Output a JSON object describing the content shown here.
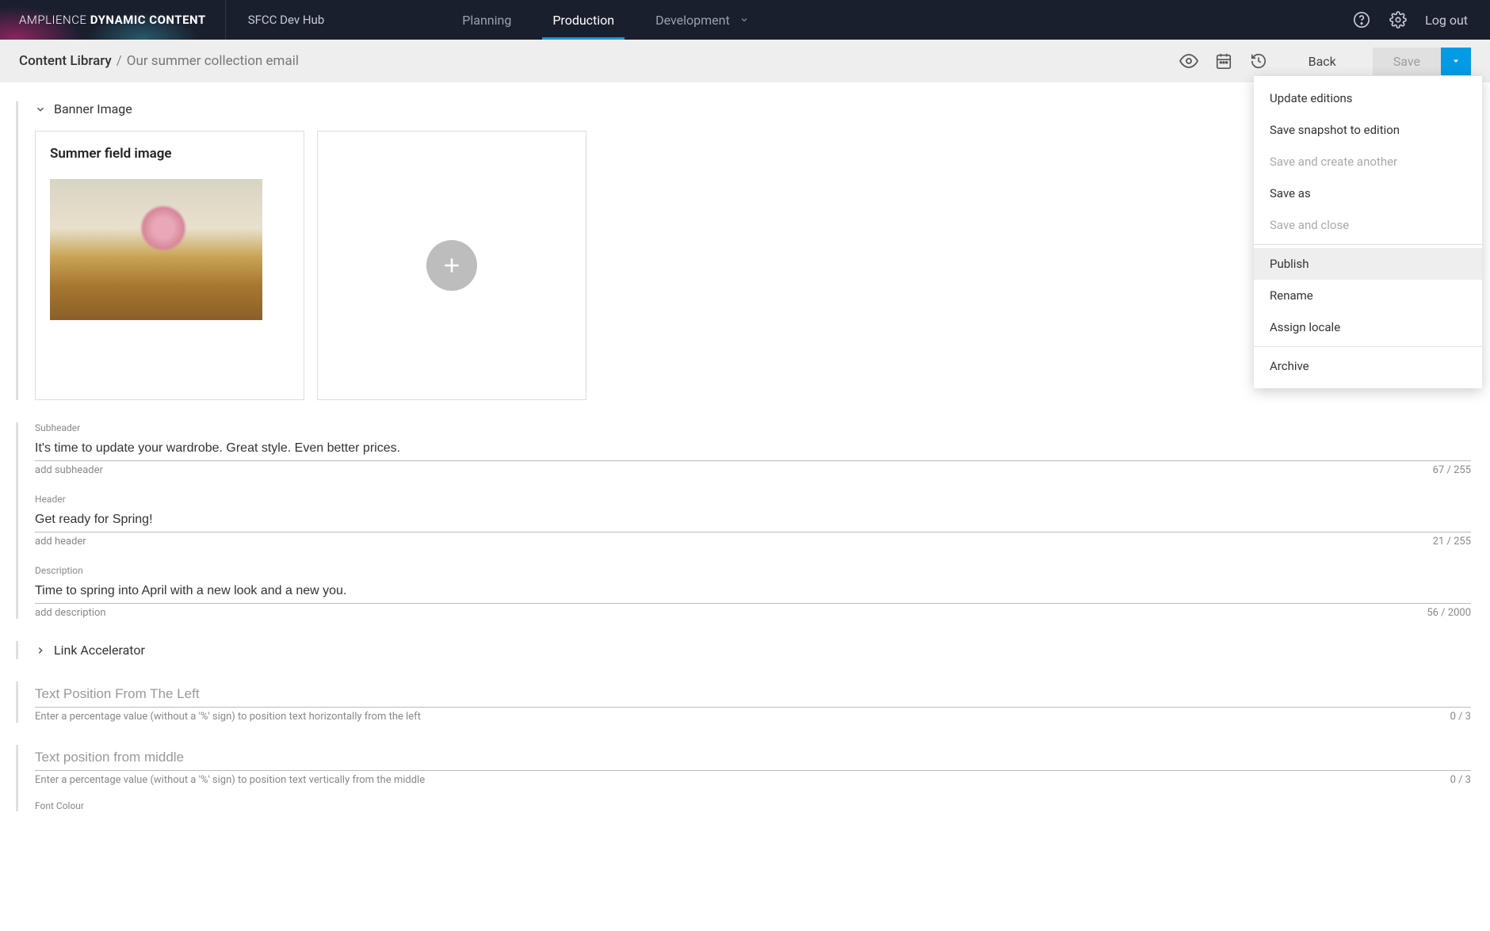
{
  "brand": {
    "light": "AMPLIENCE",
    "bold": "DYNAMIC CONTENT"
  },
  "hub": "SFCC Dev Hub",
  "nav": {
    "planning": "Planning",
    "production": "Production",
    "development": "Development"
  },
  "topbar": {
    "logout": "Log out"
  },
  "breadcrumb": {
    "root": "Content Library",
    "sep": "/",
    "current": "Our summer collection email"
  },
  "actions": {
    "back": "Back",
    "save": "Save"
  },
  "menu": {
    "update_editions": "Update editions",
    "save_snapshot": "Save snapshot to edition",
    "save_create_another": "Save and create another",
    "save_as": "Save as",
    "save_close": "Save and close",
    "publish": "Publish",
    "rename": "Rename",
    "assign_locale": "Assign locale",
    "archive": "Archive"
  },
  "banner": {
    "section_title": "Banner Image",
    "card_title": "Summer field image"
  },
  "fields": {
    "subheader": {
      "label": "Subheader",
      "value": "It's time to update your wardrobe. Great style. Even better prices.",
      "hint": "add subheader",
      "count": "67 / 255"
    },
    "header": {
      "label": "Header",
      "value": "Get ready for Spring!",
      "hint": "add header",
      "count": "21 / 255"
    },
    "description": {
      "label": "Description",
      "value": "Time to spring into April with a new look and a new you.",
      "hint": "add description",
      "count": "56 / 2000"
    },
    "link_accelerator": {
      "title": "Link Accelerator"
    },
    "text_pos_left": {
      "placeholder": "Text Position From The Left",
      "hint": "Enter a percentage value (without a '%' sign) to position text horizontally from the left",
      "count": "0 / 3"
    },
    "text_pos_middle": {
      "placeholder": "Text position from middle",
      "hint": "Enter a percentage value (without a '%' sign) to position text vertically from the middle",
      "count": "0 / 3"
    },
    "font_colour": {
      "label": "Font Colour"
    }
  }
}
